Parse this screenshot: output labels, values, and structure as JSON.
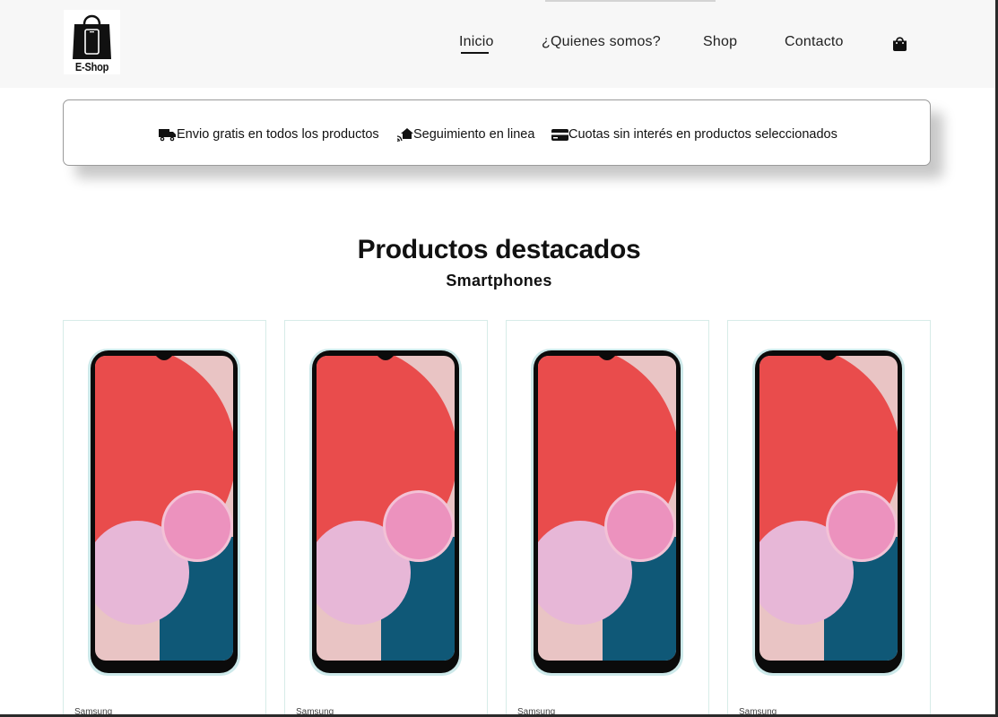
{
  "header": {
    "logo_text": "E-Shop",
    "nav": [
      {
        "label": "Inicio",
        "active": true
      },
      {
        "label": "¿Quienes somos?",
        "active": false
      },
      {
        "label": "Shop",
        "active": false
      },
      {
        "label": "Contacto",
        "active": false
      }
    ],
    "cart_icon": "shopping-bag-icon"
  },
  "features": [
    {
      "icon": "truck-icon",
      "label": "Envio gratis en todos los productos"
    },
    {
      "icon": "home-signal-icon",
      "label": "Seguimiento en linea"
    },
    {
      "icon": "credit-card-icon",
      "label": "Cuotas sin interés en productos seleccionados"
    }
  ],
  "section": {
    "title": "Productos destacados",
    "subtitle": "Smartphones"
  },
  "products": [
    {
      "brand": "Samsung"
    },
    {
      "brand": "Samsung"
    },
    {
      "brand": "Samsung"
    },
    {
      "brand": "Samsung"
    }
  ],
  "colors": {
    "header_bg": "#f7f7f7",
    "card_border": "#d7ece8",
    "text": "#111111"
  }
}
